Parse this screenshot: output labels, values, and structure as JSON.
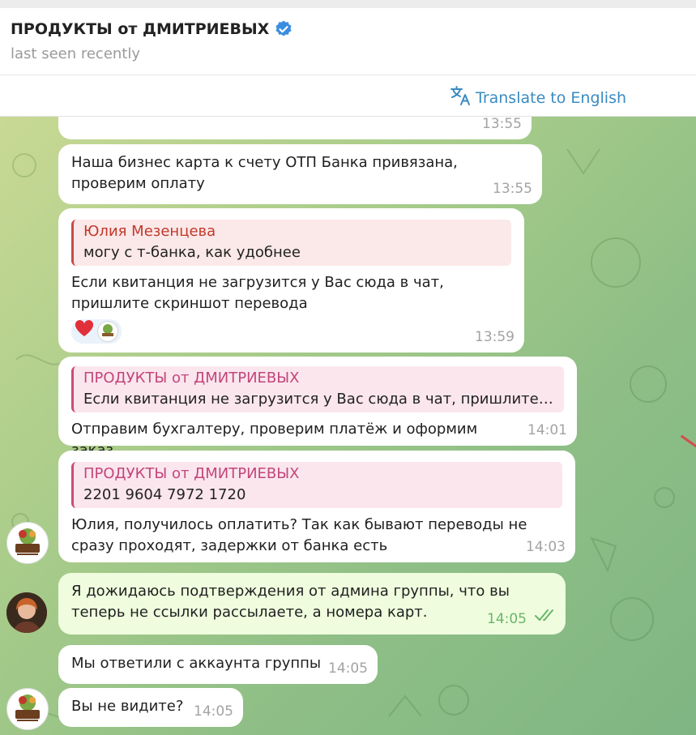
{
  "header": {
    "title": "ПРОДУКТЫ от ДМИТРИЕВЫХ",
    "status": "last seen recently",
    "translate_label": "Translate to English"
  },
  "messages": [
    {
      "time": "13:55"
    },
    {
      "text": "Наша бизнес карта к счету ОТП Банка привязана, проверим оплату",
      "time": "13:55"
    },
    {
      "quote_name": "Юлия Мезенцева",
      "quote_text": "могу с т-банка, как удобнее",
      "text": "Если квитанция не загрузится у Вас сюда в чат, пришлите скриншот перевода",
      "time": "13:59"
    },
    {
      "quote_name": "ПРОДУКТЫ от ДМИТРИЕВЫХ",
      "quote_text": "Если квитанция не загрузится у Вас сюда в чат, пришлите ск...",
      "text": "Отправим бухгалтеру, проверим платёж и оформим заказ",
      "time": "14:01"
    },
    {
      "quote_name": "ПРОДУКТЫ от ДМИТРИЕВЫХ",
      "quote_text": "2201 9604 7972 1720",
      "text": "Юлия, получилось оплатить? Так как бывают переводы не сразу проходят, задержки от банка есть",
      "time": "14:03"
    },
    {
      "text": "Я дожидаюсь подтверждения от админа группы, что вы теперь не ссылки рассылаете, а номера карт.",
      "time": "14:05"
    },
    {
      "text": "Мы ответили с аккаунта группы",
      "time": "14:05"
    },
    {
      "text": "Вы не видите?",
      "time": "14:05"
    }
  ],
  "avatar_logo_text": "Продукты Дмитриевых",
  "colors": {
    "link_blue": "#3a8bc2",
    "quote_red": "#c0392b",
    "quote_pink": "#c2467a",
    "outgoing_bubble": "#effdde",
    "read_check": "#6ab56a"
  },
  "icons": [
    "verified-icon",
    "translate-icon",
    "heart-icon",
    "double-check-icon"
  ]
}
